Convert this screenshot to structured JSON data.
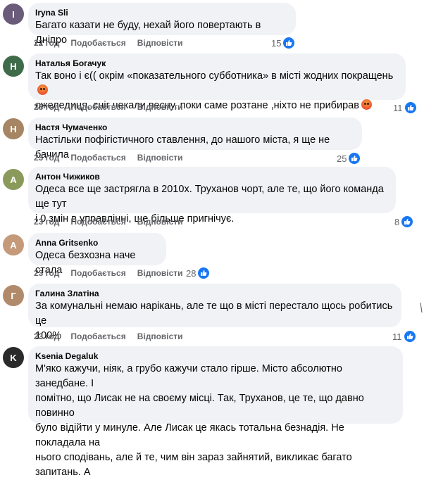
{
  "labels": {
    "like": "Подобається",
    "reply": "Відповісти"
  },
  "comments": [
    {
      "author": "Iryna Sli",
      "lines": [
        "Багато казати не буду, нехай його повертають в Дніпро"
      ],
      "time": "22 год",
      "reactions": "15",
      "avatar_color": "#6b5b7a"
    },
    {
      "author": "Наталья Богачук",
      "lines": [
        "Так воно і є(( окрім «показательного субботника» в місті жодних покращень",
        "ожеледиця, сніг чекали весну, поки саме розтане ,ніхто не прибирав"
      ],
      "time": "23 год",
      "reactions": "11",
      "avatar_color": "#3f6b4a"
    },
    {
      "author": "Настя Чумаченко",
      "lines": [
        "Настільки пофігістичного ставлення, до нашого міста, я ще не бачила"
      ],
      "time": "23 год",
      "reactions": "25",
      "avatar_color": "#a58563"
    },
    {
      "author": "Антон Чижиков",
      "lines": [
        "Одеса все ще застрягла в 2010х. Труханов чорт, але те, що його команда ще тут",
        "і 0 змін в управлінні, ще більше пригнічує."
      ],
      "time": "23 год",
      "reactions": "8",
      "avatar_color": "#8a9a5b"
    },
    {
      "author": "Anna Gritsenko",
      "lines": [
        "Одеса безхозна наче стала"
      ],
      "time": "23 год",
      "reactions": "28",
      "avatar_color": "#c49a7b"
    },
    {
      "author": "Галина Златіна",
      "lines": [
        "За комунальні немаю нарікань, але те що в місті перестало щось робитись це",
        "100%"
      ],
      "time": "23 год",
      "reactions": "11",
      "avatar_color": "#b08a6a"
    },
    {
      "author": "Ksenia Degaluk",
      "lines": [
        "М'яко кажучи, ніяк, а грубо кажучи стало гірше. Місто абсолютно занедбане. І",
        "помітно, що Лисак не на своєму місці. Так, Труханов, це те, що давно повинно",
        "було відійти у минуле. Але Лисак це якась тотальна безнадія. Не покладала на",
        "нього сподівань, але й те, чим він зараз зайнятий, викликає багато запитань. А"
      ],
      "time": "",
      "reactions": "",
      "avatar_color": "#2b2b2b"
    }
  ]
}
